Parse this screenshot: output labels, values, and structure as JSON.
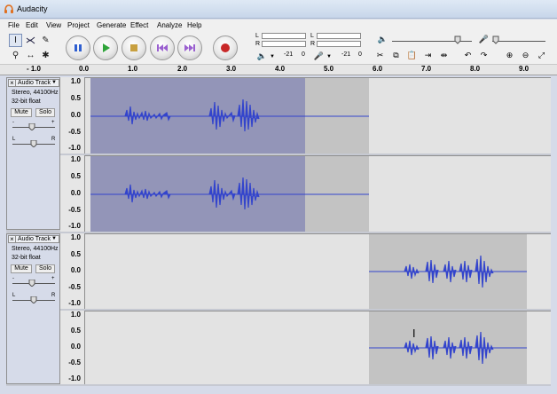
{
  "window": {
    "title": "Audacity"
  },
  "menu": [
    "File",
    "Edit",
    "View",
    "Project",
    "Generate",
    "Effect",
    "Analyze",
    "Help"
  ],
  "tools": {
    "row1": [
      "selection-tool",
      "envelope-tool",
      "draw-tool"
    ],
    "row2": [
      "zoom-tool",
      "timeshift-tool",
      "multi-tool"
    ]
  },
  "meters": {
    "play": {
      "l": "L",
      "r": "R"
    },
    "record": {
      "l": "L",
      "r": "R"
    },
    "scale_play": [
      "-21",
      "0"
    ],
    "scale_record": [
      "-21",
      "0"
    ]
  },
  "ruler": {
    "labels": [
      "- 1.0",
      "0.0",
      "1.0",
      "2.0",
      "3.0",
      "4.0",
      "5.0",
      "6.0",
      "7.0",
      "8.0",
      "9.0"
    ]
  },
  "tracks": [
    {
      "name": "Audio Track",
      "info1": "Stereo, 44100Hz",
      "info2": "32-bit float",
      "mute": "Mute",
      "solo": "Solo",
      "gain_minus": "-",
      "gain_plus": "+",
      "pan_left": "L",
      "pan_right": "R",
      "scale": [
        "1.0",
        "0.5",
        "0.0",
        "-0.5",
        "-1.0"
      ]
    },
    {
      "name": "Audio Track",
      "info1": "Stereo, 44100Hz",
      "info2": "32-bit float",
      "mute": "Mute",
      "solo": "Solo",
      "gain_minus": "-",
      "gain_plus": "+",
      "pan_left": "L",
      "pan_right": "R",
      "scale": [
        "1.0",
        "0.5",
        "0.0",
        "-0.5",
        "-1.0"
      ]
    }
  ],
  "colors": {
    "waveform": "#3344cc",
    "selection": "#9395b8",
    "clip": "#c3c3c3",
    "background": "#e3e3e3"
  }
}
